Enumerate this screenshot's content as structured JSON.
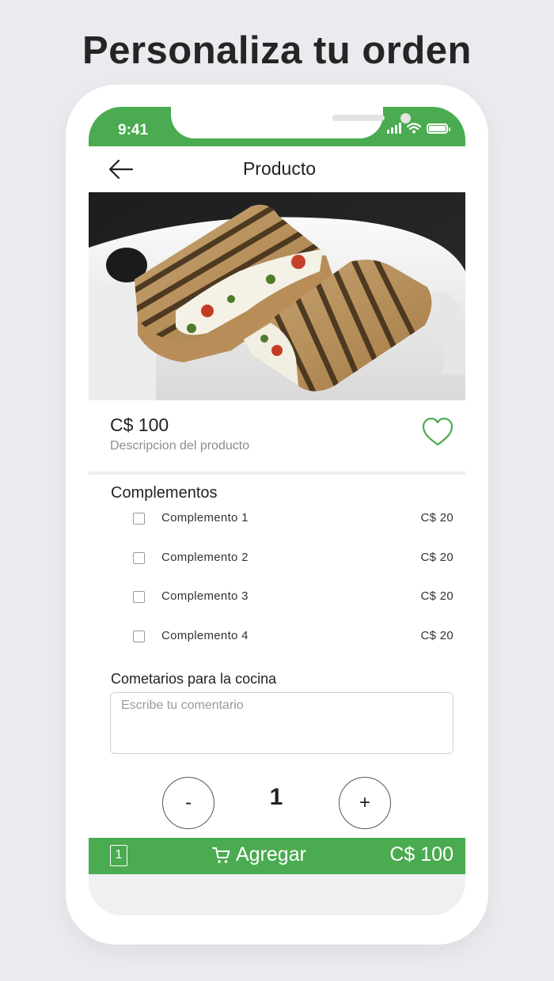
{
  "headline": "Personaliza tu orden",
  "status_bar": {
    "time": "9:41",
    "color": "#4aab50"
  },
  "nav": {
    "title": "Producto",
    "back_icon": "arrow-left-icon"
  },
  "product": {
    "image": "grilled-panini-sandwich-photo",
    "price": "C$ 100",
    "description": "Descripcion del producto",
    "favorite_icon": "heart-outline-icon"
  },
  "complements": {
    "title": "Complementos",
    "items": [
      {
        "name": "Complemento 1",
        "price": "C$ 20"
      },
      {
        "name": "Complemento 2",
        "price": "C$ 20"
      },
      {
        "name": "Complemento 3",
        "price": "C$ 20"
      },
      {
        "name": "Complemento 4",
        "price": "C$ 20"
      }
    ]
  },
  "comments": {
    "title": "Cometarios para la cocina",
    "placeholder": "Escribe tu comentario",
    "value": ""
  },
  "quantity": {
    "minus_label": "-",
    "value": "1",
    "plus_label": "+"
  },
  "add_bar": {
    "count": "1",
    "label": "Agregar",
    "total": "C$ 100",
    "cart_icon": "cart-icon",
    "color": "#4aab50"
  }
}
